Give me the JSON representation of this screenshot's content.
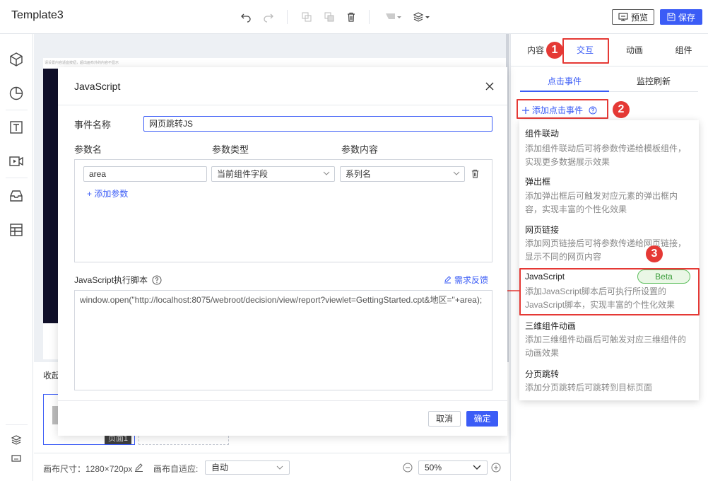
{
  "app": {
    "title": "Template3"
  },
  "toolbar": {
    "undo_icon": "undo-icon",
    "redo_icon": "redo-icon",
    "copy_icon": "copy-icon",
    "paste_icon": "paste-icon",
    "delete_icon": "trash-icon",
    "preview_label": "预览",
    "save_label": "保存"
  },
  "canvas": {
    "tip": "请设置内容适宜按钮，超出画布外的内容不显示",
    "collapse_label": "收起",
    "page_tag": "页面1"
  },
  "statusbar": {
    "canvas_size": "画布尺寸：1280×720px",
    "adapt_label": "画布自适应:",
    "adapt_value": "自动",
    "zoom_value": "50%"
  },
  "right_panel": {
    "tabs": [
      {
        "label": "内容"
      },
      {
        "label": "交互"
      },
      {
        "label": "动画"
      },
      {
        "label": "组件"
      }
    ],
    "sub_tabs": [
      {
        "label": "点击事件"
      },
      {
        "label": "监控刷新"
      }
    ],
    "add_event_label": "添加点击事件",
    "events": [
      {
        "title": "组件联动",
        "desc": "添加组件联动后可将参数传递给模板组件，实现更多数据展示效果"
      },
      {
        "title": "弹出框",
        "desc": "添加弹出框后可触发对应元素的弹出框内容，实现丰富的个性化效果"
      },
      {
        "title": "网页链接",
        "desc": "添加网页链接后可将参数传递给网页链接，显示不同的网页内容"
      },
      {
        "title": "JavaScript",
        "desc": "添加JavaScript脚本后可执行所设置的JavaScript脚本，实现丰富的个性化效果",
        "badge": "Beta"
      },
      {
        "title": "三维组件动画",
        "desc": "添加三维组件动画后可触发对应三维组件的动画效果"
      },
      {
        "title": "分页跳转",
        "desc": "添加分页跳转后可跳转到目标页面"
      }
    ],
    "badges": [
      "1",
      "2",
      "3"
    ]
  },
  "dialog": {
    "title": "JavaScript",
    "event_name_label": "事件名称",
    "event_name_value": "网页跳转JS",
    "param_name_header": "参数名",
    "param_type_header": "参数类型",
    "param_content_header": "参数内容",
    "params": [
      {
        "name": "area",
        "type": "当前组件字段",
        "content": "系列名"
      }
    ],
    "add_param_label": "+ 添加参数",
    "script_label": "JavaScript执行脚本",
    "feedback_label": "需求反馈",
    "script": "window.open(\"http://localhost:8075/webroot/decision/view/report?viewlet=GettingStarted.cpt&地区=\"+area);",
    "cancel_label": "取消",
    "confirm_label": "确定"
  }
}
